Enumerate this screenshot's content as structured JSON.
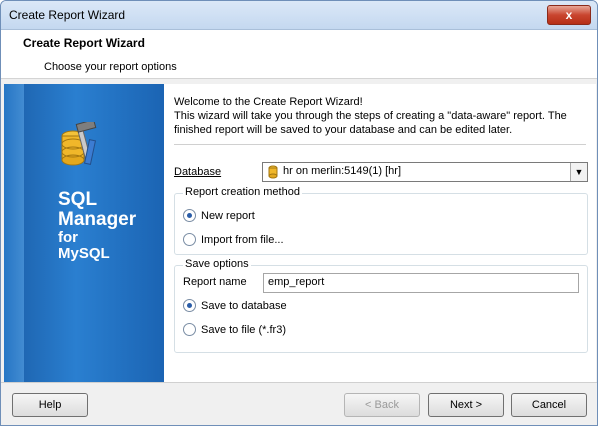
{
  "window": {
    "title": "Create Report Wizard",
    "close_glyph": "x"
  },
  "header": {
    "title": "Create Report Wizard",
    "subtitle": "Choose your report options"
  },
  "sidebar": {
    "product_line1": "SQL",
    "product_line2": "Manager",
    "product_line3": "for",
    "product_line4": "MySQL"
  },
  "welcome": {
    "line1": "Welcome to the Create Report Wizard!",
    "line2": "This wizard will take you through the steps of creating a \"data-aware\" report. The",
    "line3": "finished report will be saved to your database and can be edited later."
  },
  "database": {
    "label": "Database",
    "value": "hr on merlin:5149(1) [hr]"
  },
  "creation_method": {
    "legend": "Report creation method",
    "options": [
      {
        "label": "New report",
        "selected": true
      },
      {
        "label": "Import from file...",
        "selected": false
      }
    ]
  },
  "save_options": {
    "legend": "Save options",
    "report_name_label": "Report name",
    "report_name_value": "emp_report",
    "options": [
      {
        "label": "Save to database",
        "selected": true
      },
      {
        "label": "Save to file (*.fr3)",
        "selected": false
      }
    ]
  },
  "buttons": {
    "help": "Help",
    "back": "< Back",
    "next": "Next >",
    "cancel": "Cancel"
  },
  "colors": {
    "sidebar": "#1b64b3",
    "accent": "#2a5da8"
  }
}
